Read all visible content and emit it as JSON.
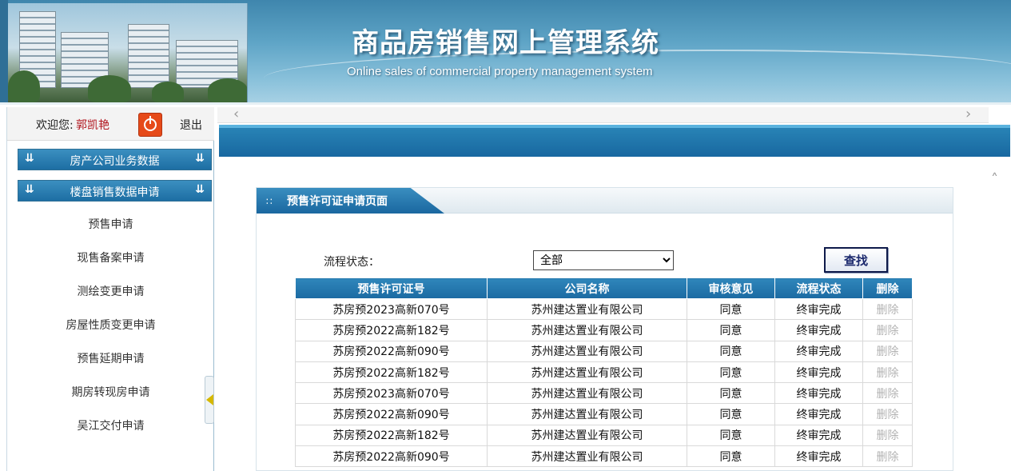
{
  "header": {
    "title": "商品房销售网上管理系统",
    "subtitle": "Online sales of commercial property management system"
  },
  "sidebar": {
    "welcome_label": "欢迎您:",
    "username": "郭凯艳",
    "logout_label": "退出",
    "groups": [
      {
        "label": "房产公司业务数据"
      },
      {
        "label": "楼盘销售数据申请"
      }
    ],
    "items": [
      {
        "label": "预售申请"
      },
      {
        "label": "现售备案申请"
      },
      {
        "label": "测绘变更申请"
      },
      {
        "label": "房屋性质变更申请"
      },
      {
        "label": "预售延期申请"
      },
      {
        "label": "期房转现房申请"
      },
      {
        "label": "吴江交付申请"
      }
    ]
  },
  "panel": {
    "title": "预售许可证申请页面"
  },
  "filter": {
    "label": "流程状态：",
    "selected": "全部",
    "search_label": "查找"
  },
  "table": {
    "headers": [
      "预售许可证号",
      "公司名称",
      "审核意见",
      "流程状态",
      "删除"
    ],
    "rows": [
      [
        "苏房预2023高新070号",
        "苏州建达置业有限公司",
        "同意",
        "终审完成",
        "删除"
      ],
      [
        "苏房预2022高新182号",
        "苏州建达置业有限公司",
        "同意",
        "终审完成",
        "删除"
      ],
      [
        "苏房预2022高新090号",
        "苏州建达置业有限公司",
        "同意",
        "终审完成",
        "删除"
      ],
      [
        "苏房预2022高新182号",
        "苏州建达置业有限公司",
        "同意",
        "终审完成",
        "删除"
      ],
      [
        "苏房预2023高新070号",
        "苏州建达置业有限公司",
        "同意",
        "终审完成",
        "删除"
      ],
      [
        "苏房预2022高新090号",
        "苏州建达置业有限公司",
        "同意",
        "终审完成",
        "删除"
      ],
      [
        "苏房预2022高新182号",
        "苏州建达置业有限公司",
        "同意",
        "终审完成",
        "删除"
      ],
      [
        "苏房预2022高新090号",
        "苏州建达置业有限公司",
        "同意",
        "终审完成",
        "删除"
      ]
    ]
  },
  "icons": {
    "power": "power-icon",
    "chevron_double_down": "chevron-double-down-icon",
    "scroll_left": "chevron-left-icon",
    "scroll_right": "chevron-right-icon",
    "scroll_up": "chevron-up-icon",
    "collapse": "triangle-left-icon"
  },
  "colors": {
    "accent": "#1d6ea3",
    "username": "#b0121b",
    "logout_button": "#e64a19",
    "disabled_text": "#b3b3b3"
  }
}
